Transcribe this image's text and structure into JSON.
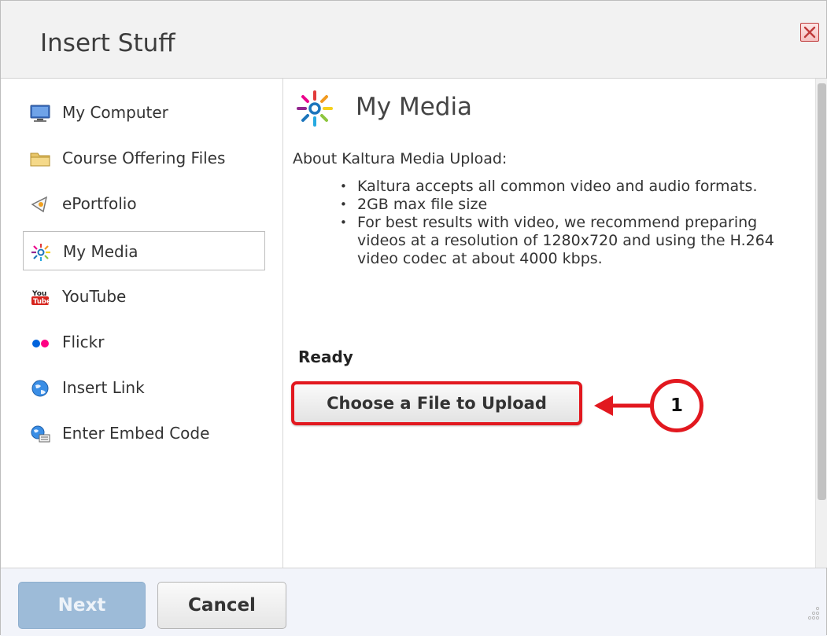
{
  "dialog": {
    "title": "Insert Stuff",
    "close_icon": "close-icon"
  },
  "sidebar": {
    "items": [
      {
        "label": "My Computer",
        "icon": "monitor-icon",
        "selected": false
      },
      {
        "label": "Course Offering Files",
        "icon": "folder-icon",
        "selected": false
      },
      {
        "label": "ePortfolio",
        "icon": "eportfolio-icon",
        "selected": false
      },
      {
        "label": "My Media",
        "icon": "kaltura-icon",
        "selected": true
      },
      {
        "label": "YouTube",
        "icon": "youtube-icon",
        "selected": false
      },
      {
        "label": "Flickr",
        "icon": "flickr-icon",
        "selected": false
      },
      {
        "label": "Insert Link",
        "icon": "globe-icon",
        "selected": false
      },
      {
        "label": "Enter Embed Code",
        "icon": "embed-icon",
        "selected": false
      }
    ]
  },
  "content": {
    "heading": "My Media",
    "about": "About Kaltura Media Upload:",
    "bullets": [
      "Kaltura accepts all common video and audio formats.",
      "2GB max file size",
      "For best results with video, we recommend preparing videos at a resolution of 1280x720 and using the H.264 video codec at about 4000 kbps."
    ],
    "status": "Ready",
    "upload_button": "Choose a File to Upload"
  },
  "annotation": {
    "step_number": "1",
    "color": "#e2181f"
  },
  "footer": {
    "next_label": "Next",
    "cancel_label": "Cancel",
    "next_disabled": true
  },
  "colors": {
    "accent_red": "#e2181f",
    "next_button": "#9dbbd8",
    "header_bg": "#f2f2f2"
  }
}
